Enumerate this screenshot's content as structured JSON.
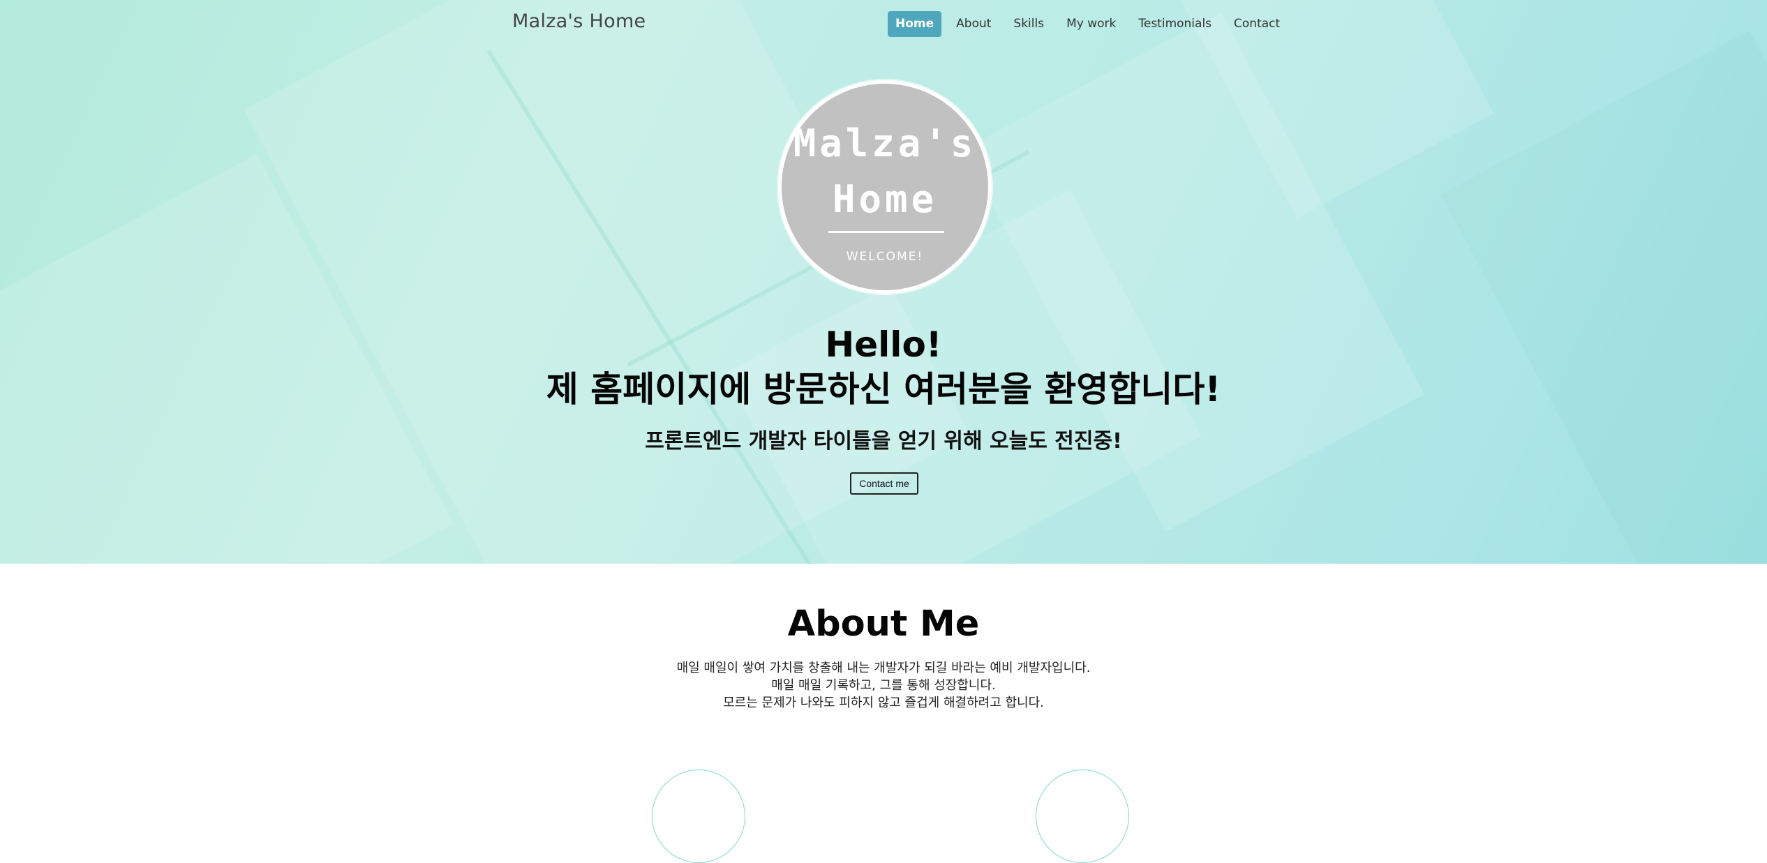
{
  "brand": "Malza's Home",
  "nav": [
    {
      "label": "Home",
      "active": true
    },
    {
      "label": "About",
      "active": false
    },
    {
      "label": "Skills",
      "active": false
    },
    {
      "label": "My work",
      "active": false
    },
    {
      "label": "Testimonials",
      "active": false
    },
    {
      "label": "Contact",
      "active": false
    }
  ],
  "logo": {
    "title": "Malza's\nHome",
    "welcome": "WELCOME!"
  },
  "hero": {
    "title_line1": "Hello!",
    "title_line2": "제 홈페이지에 방문하신 여러분을 환영합니다!",
    "subtitle": "프론트엔드 개발자 타이틀을 얻기 위해 오늘도 전진중!",
    "button": "Contact me"
  },
  "about": {
    "title": "About Me",
    "lines": [
      "매일 매일이 쌓여 가치를 창출해 내는 개발자가 되길 바라는 예비 개발자입니다.",
      "매일 매일 기록하고, 그를 통해 성장합니다.",
      "모르는 문제가 나와도 피하지 않고 즐겁게 해결하려고 합니다."
    ]
  },
  "colors": {
    "accent": "#4fa7bd",
    "hero_gradient_start": "#b3ebdc",
    "hero_gradient_end": "#9fe0e4",
    "logo_bg": "#c1c1c1"
  }
}
